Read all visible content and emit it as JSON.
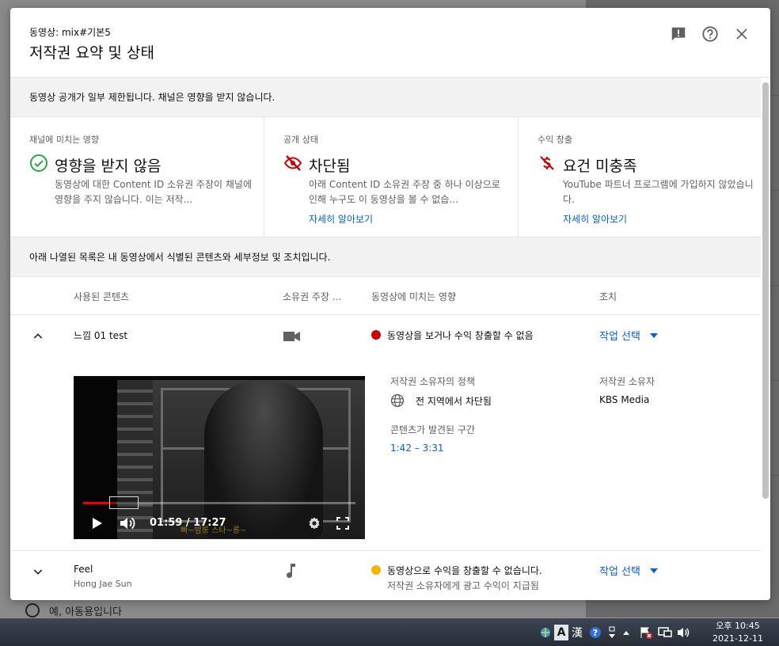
{
  "background": {
    "radio_text": "예, 아동용입니다"
  },
  "dialog": {
    "subtitle": "동영상: mix#기본5",
    "title": "저작권 요약 및 상태",
    "notice_restricted": "동영상 공개가 일부 제한됩니다. 채널은 영향을 받지 않습니다.",
    "notice_list": "아래 나열된 목록은 내 동영상에서 식별된 콘텐츠와 세부정보 및 조치입니다."
  },
  "cards": [
    {
      "label": "채널에 미치는 영향",
      "status": "영향을 받지 않음",
      "desc": "동영상에 대한 Content ID 소유권 주장이 채널에 영향을 주지 않습니다. 이는 저작...",
      "link": "",
      "icon": "check-circle-icon"
    },
    {
      "label": "공개 상태",
      "status": "차단됨",
      "desc": "아래 Content ID 소유권 주장 중 하나 이상으로 인해 누구도 이 동영상을 볼 수 없습...",
      "link": "자세히 알아보기",
      "icon": "eye-off-icon"
    },
    {
      "label": "수익 창출",
      "status": "요건 미충족",
      "desc": "YouTube 파트너 프로그램에 가입하지 않았습니다.",
      "link": "자세히 알아보기",
      "icon": "no-money-icon"
    }
  ],
  "table": {
    "col_content": "사용된 콘텐츠",
    "col_claim": "소유권 주장 ...",
    "col_impact": "동영상에 미치는 영향",
    "col_action": "조치"
  },
  "rows": [
    {
      "name": "느낌 01 test",
      "type_icon": "video-camera-icon",
      "impact": "동영상을 보거나 수익 창출할 수 없음",
      "impact_color": "#cc0000",
      "action": "작업 선택",
      "policy_label": "저작권 소유자의 정책",
      "policy_value": "전 지역에서 차단됨",
      "owner_label": "저작권 소유자",
      "owner_value": "KBS Media",
      "segment_label": "콘텐츠가 발견된 구간",
      "segment_value": "1:42 – 3:31",
      "player": {
        "time": "01:59 / 17:27",
        "progress": 0.12,
        "subtitle": "빠~밤롱 스타~롱~"
      }
    },
    {
      "name": "Feel",
      "artist": "Hong Jae Sun",
      "type_icon": "music-note-icon",
      "impact": "동영상으로 수익을 창출할 수 없습니다.",
      "impact_sub": "저작권 소유자에게 광고 수익이 지급됨",
      "impact_color": "#f4b400",
      "action": "작업 선택"
    }
  ],
  "taskbar": {
    "ime_a": "A",
    "ime_han": "漢",
    "clock_line1": "오후 10:45",
    "clock_line2": "2021-12-11"
  }
}
